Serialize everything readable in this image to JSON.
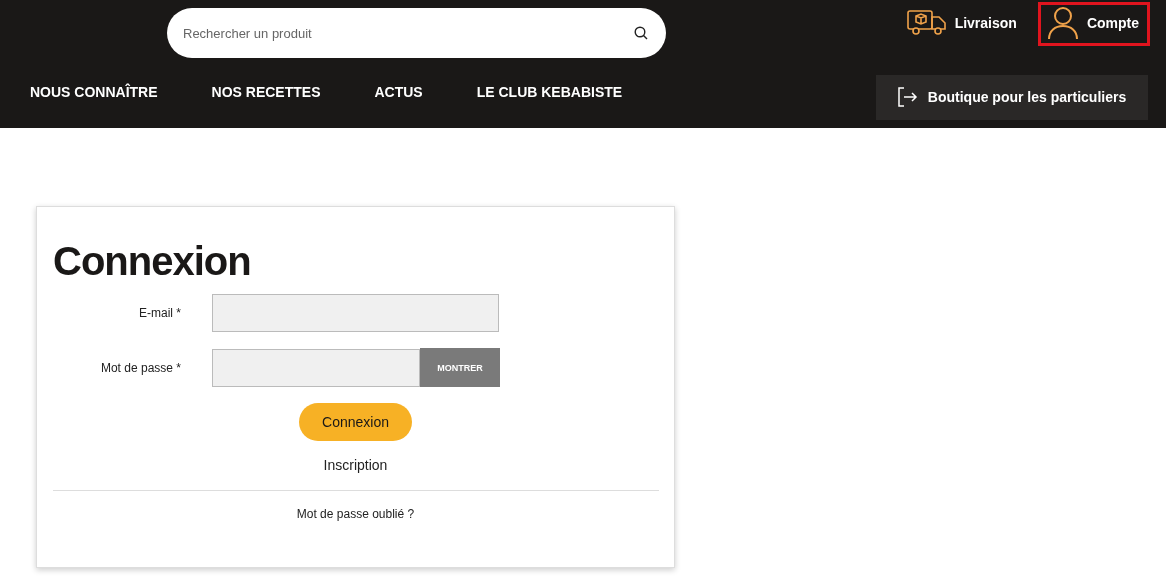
{
  "header": {
    "search": {
      "placeholder": "Rechercher un produit"
    },
    "links": [
      {
        "label": "Livraison",
        "kind": "truck",
        "selected": false
      },
      {
        "label": "Compte",
        "kind": "user",
        "selected": true
      }
    ],
    "nav": [
      "NOUS CONNAÎTRE",
      "NOS RECETTES",
      "ACTUS",
      "LE CLUB KEBABISTE"
    ],
    "shop_button": "Boutique pour les particuliers"
  },
  "login": {
    "title": "Connexion",
    "fields": [
      {
        "label": "E-mail *",
        "kind": "text"
      },
      {
        "label": "Mot de passe *",
        "kind": "password",
        "toggle": "MONTRER"
      }
    ],
    "submit": "Connexion",
    "register": "Inscription",
    "forgot": "Mot de passe oublié ?"
  }
}
